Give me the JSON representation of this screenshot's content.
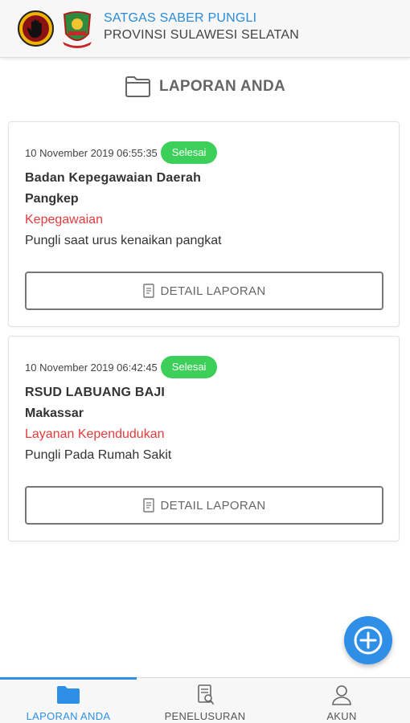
{
  "header": {
    "title": "SATGAS SABER PUNGLI",
    "subtitle": "PROVINSI SULAWESI SELATAN"
  },
  "page": {
    "title": "LAPORAN ANDA",
    "icon": "folder-icon"
  },
  "reports": [
    {
      "date": "10 November 2019 06:55:35",
      "status": "Selesai",
      "agency": "Badan Kepegawaian Daerah",
      "city": "Pangkep",
      "category": "Kepegawaian",
      "description": "Pungli saat urus kenaikan pangkat",
      "button_label": "DETAIL LAPORAN"
    },
    {
      "date": "10 November 2019 06:42:45",
      "status": "Selesai",
      "agency": "RSUD LABUANG BAJI",
      "city": "Makassar",
      "category": "Layanan Kependudukan",
      "description": "Pungli Pada Rumah Sakit",
      "button_label": "DETAIL LAPORAN"
    }
  ],
  "fab": {
    "icon": "plus-circle-icon"
  },
  "bottom_nav": [
    {
      "label": "LAPORAN ANDA",
      "icon": "folder-icon",
      "active": true
    },
    {
      "label": "PENELUSURAN",
      "icon": "document-search-icon",
      "active": false
    },
    {
      "label": "AKUN",
      "icon": "user-icon",
      "active": false
    }
  ],
  "colors": {
    "accent": "#2f8ee6",
    "status_done": "#3ccf5a",
    "category": "#e23b3b"
  }
}
